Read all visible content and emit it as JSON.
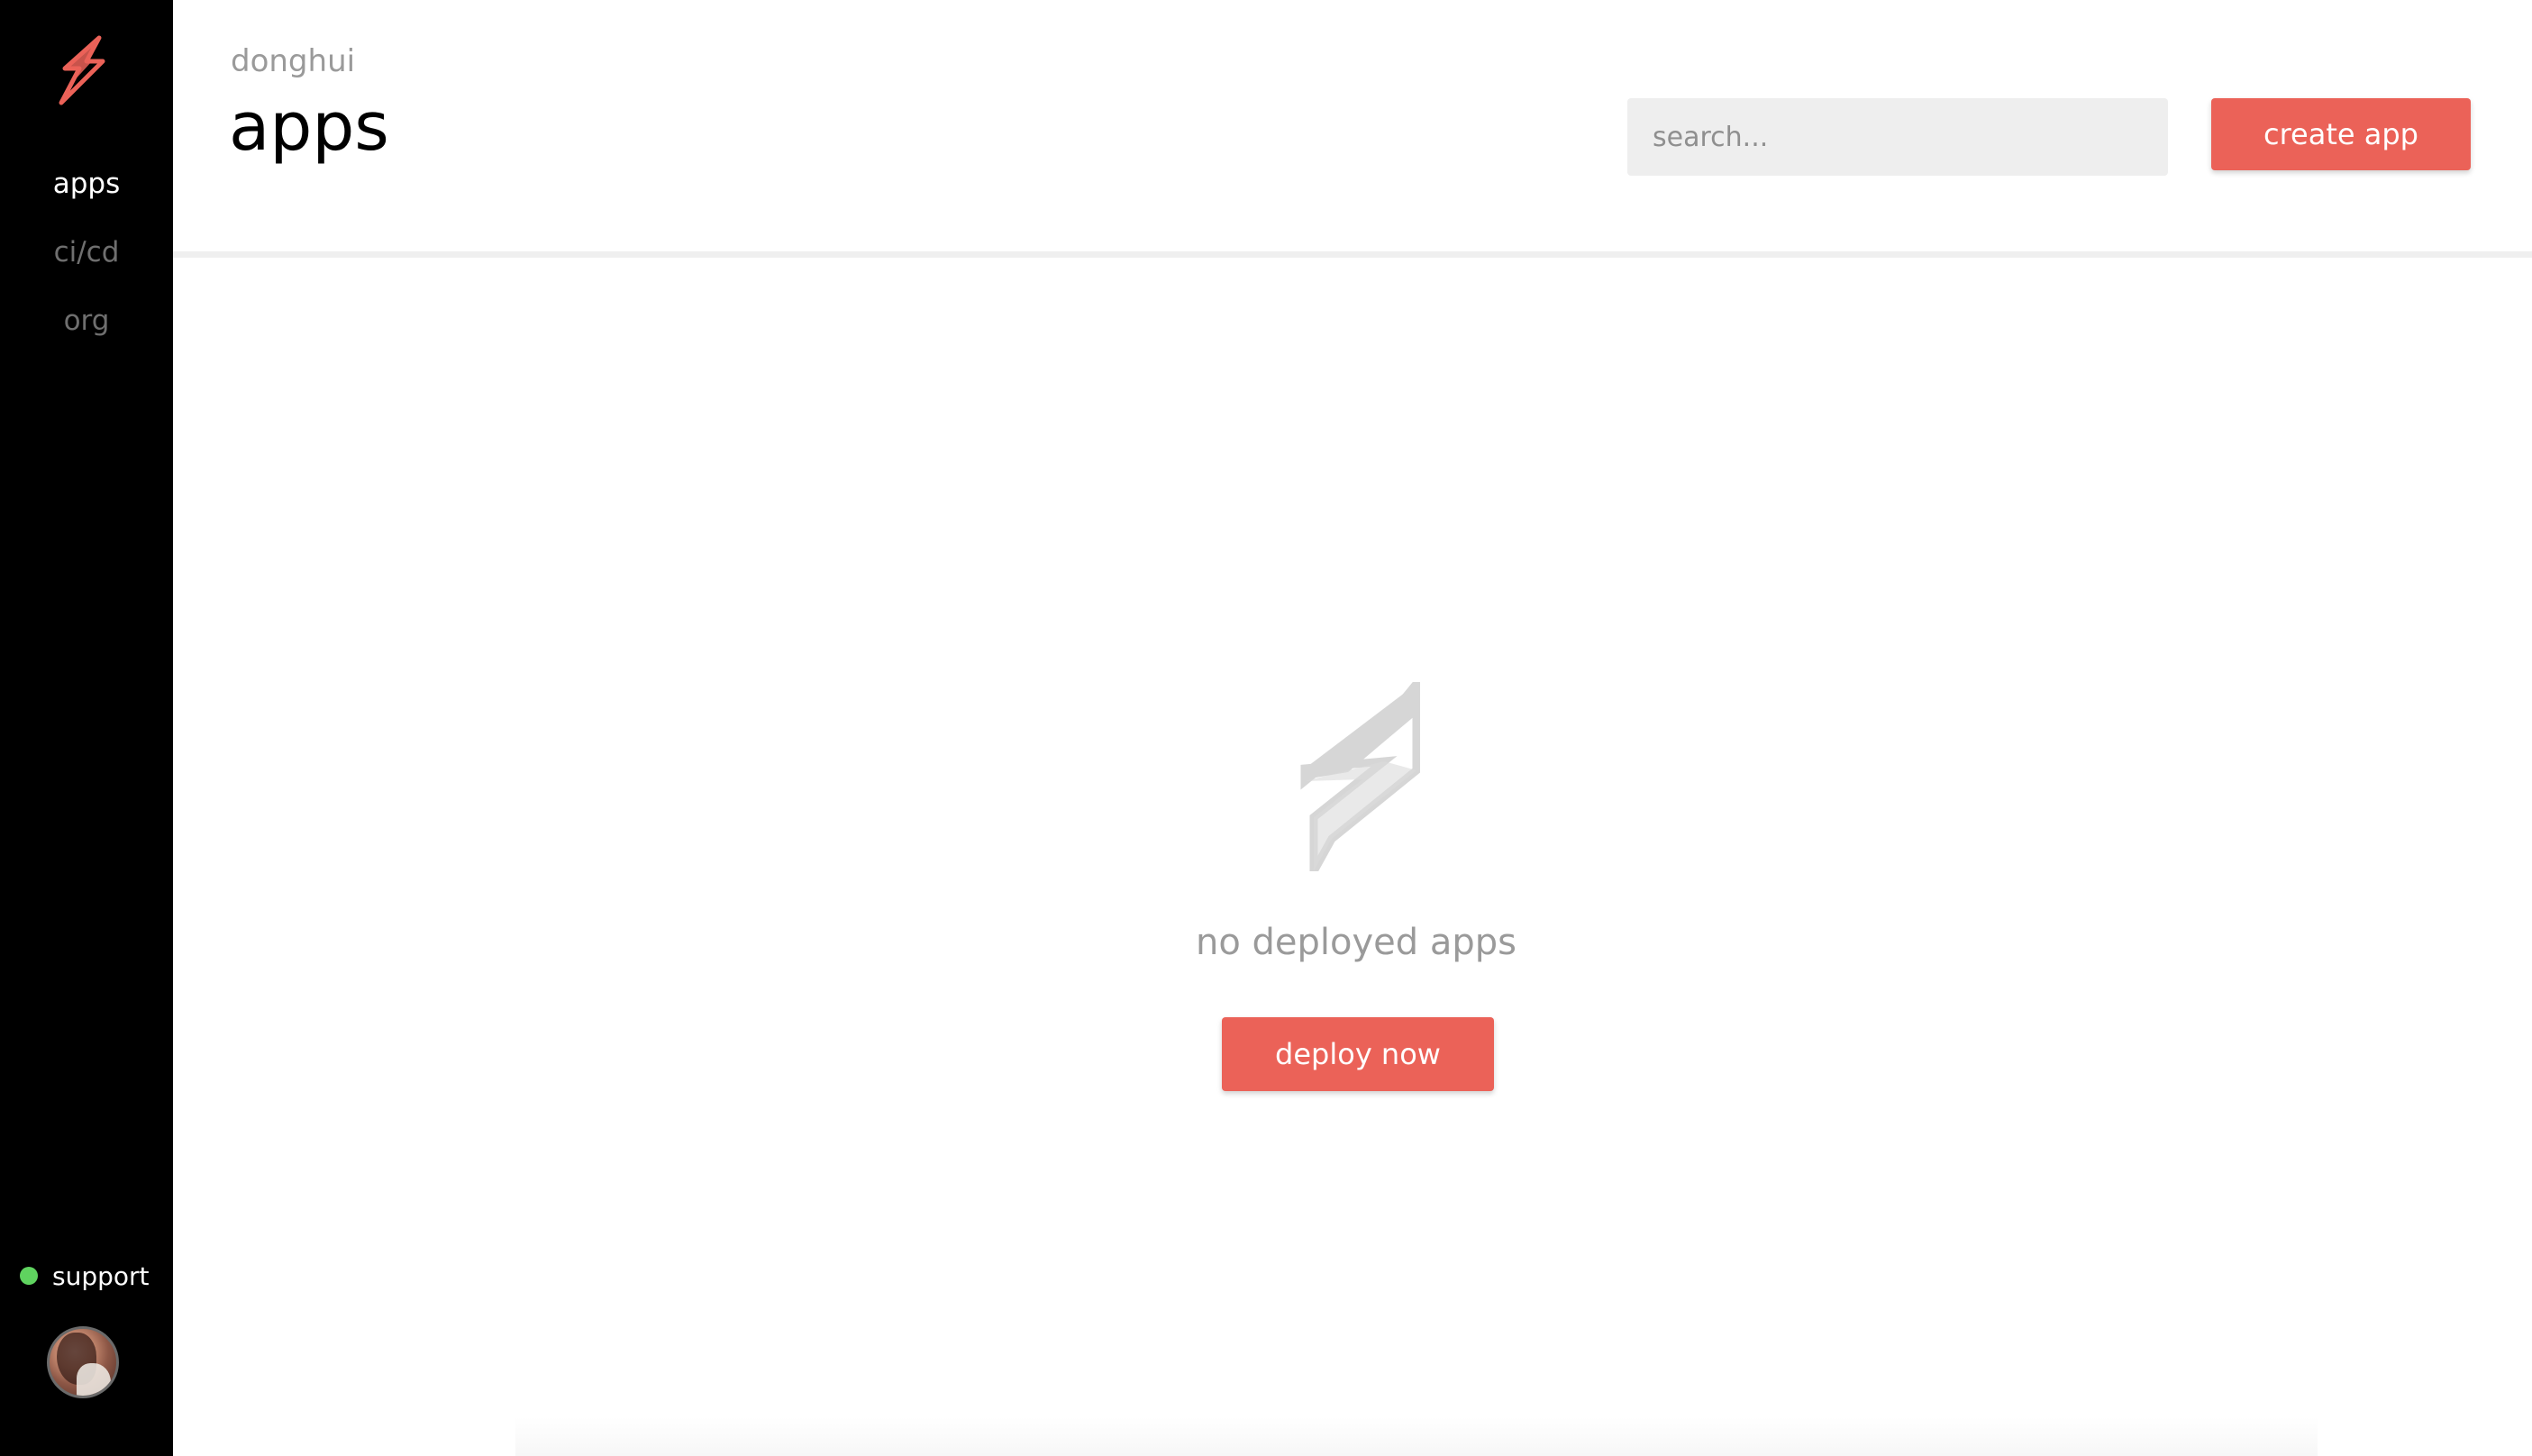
{
  "colors": {
    "sidebar_bg": "#000000",
    "accent": "#eb6258",
    "status_online": "#5fd35f",
    "muted_text": "#9a9a9a",
    "search_bg": "#eeeeee"
  },
  "sidebar": {
    "logo_icon": "lightning-bolt-icon",
    "items": [
      {
        "label": "apps",
        "active": true
      },
      {
        "label": "ci/cd",
        "active": false
      },
      {
        "label": "org",
        "active": false
      }
    ],
    "support": {
      "label": "support",
      "status": "online"
    },
    "avatar_icon": "user-avatar"
  },
  "header": {
    "org_name": "donghui",
    "title": "apps",
    "search_placeholder": "search...",
    "create_button_label": "create app"
  },
  "empty_state": {
    "icon": "lightning-bolt-outline-icon",
    "message": "no deployed apps",
    "button_label": "deploy now"
  }
}
